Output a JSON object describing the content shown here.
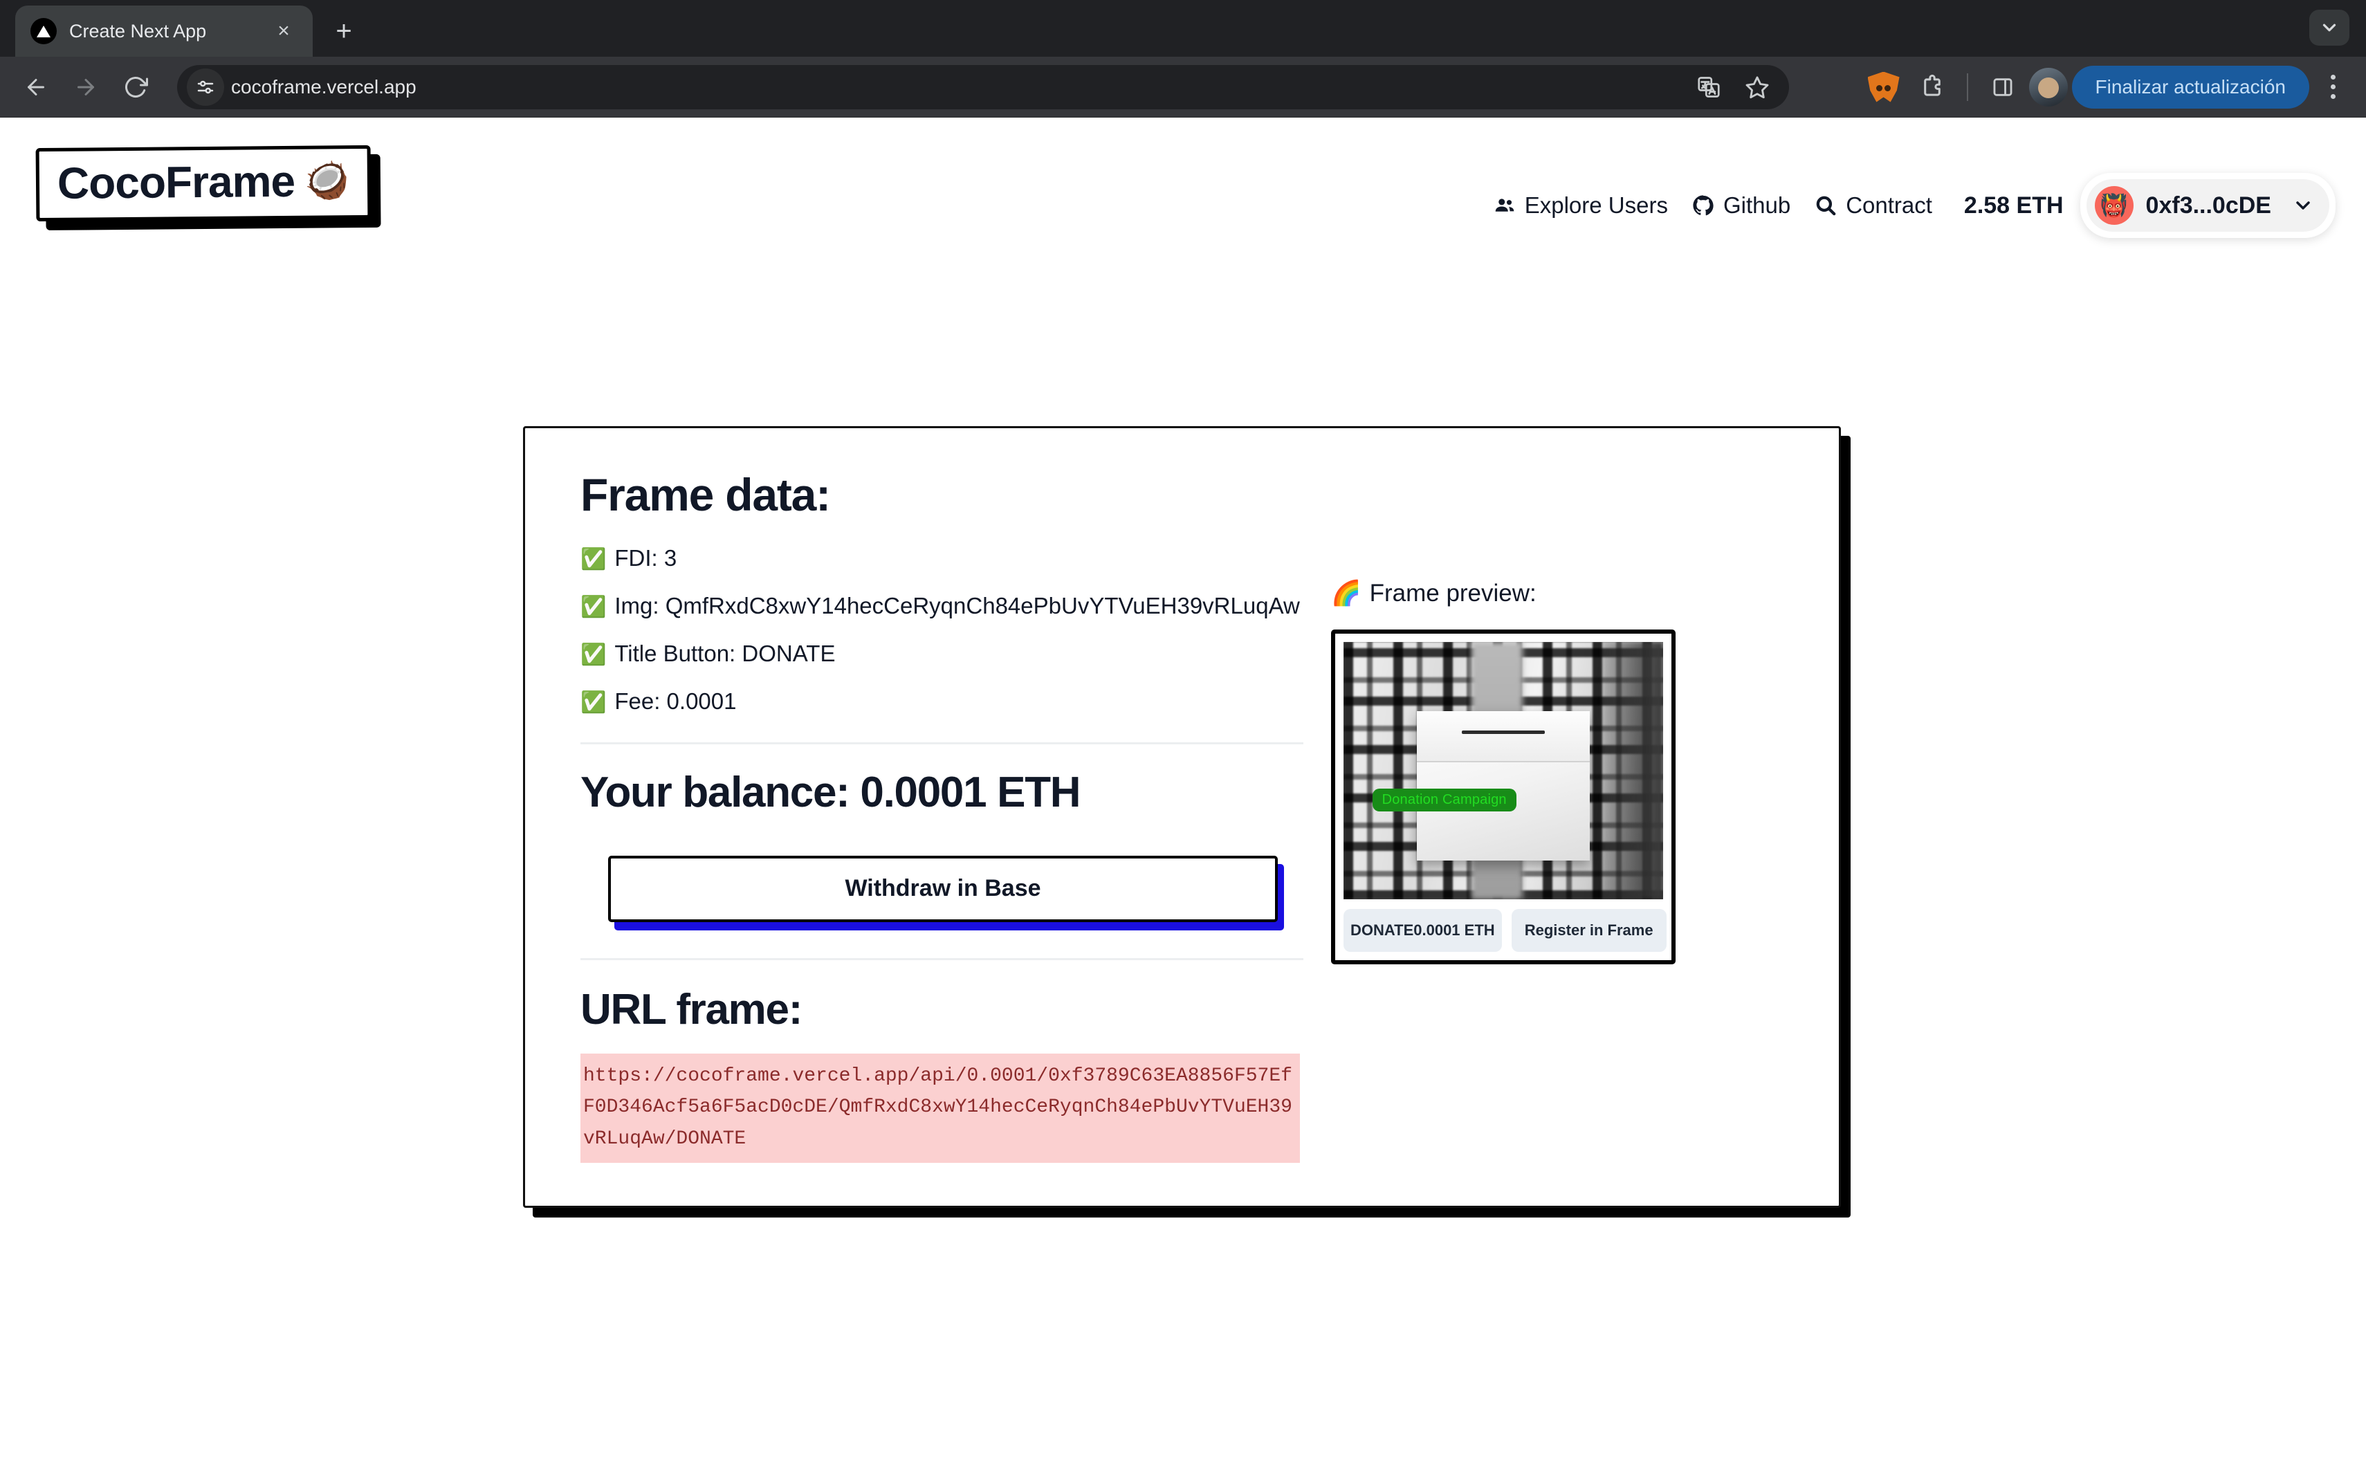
{
  "browser": {
    "tab": {
      "title": "Create Next App",
      "favicon": "nextjs-triangle-icon",
      "close_label": "×"
    },
    "new_tab_label": "+",
    "omnibox": {
      "url": "cocoframe.vercel.app",
      "site_settings_icon": "tune-icon"
    },
    "toolbar": {
      "back_icon": "back-arrow-icon",
      "forward_icon": "forward-arrow-icon",
      "reload_icon": "reload-icon",
      "translate_icon": "translate-icon",
      "bookmark_icon": "star-icon",
      "metamask_icon": "metamask-fox-icon",
      "extensions_icon": "extensions-puzzle-icon",
      "side_panel_icon": "side-panel-icon",
      "profile_icon": "profile-avatar",
      "update_button": "Finalizar actualización",
      "menu_icon": "three-dot-menu-icon"
    },
    "tab_list_icon": "chevron-down-icon"
  },
  "app": {
    "logo": {
      "text": "CocoFrame",
      "emoji": "🥥"
    },
    "nav": {
      "items": [
        {
          "label": "Explore Users",
          "icon": "people-icon"
        },
        {
          "label": "Github",
          "icon": "github-icon"
        },
        {
          "label": "Contract",
          "icon": "search-icon"
        }
      ],
      "eth_balance": "2.58 ETH",
      "wallet": {
        "address": "0xf3...0cDE",
        "avatar": "👹",
        "chevron": "chevron-down-icon"
      }
    },
    "frame_data": {
      "heading": "Frame data:",
      "items": [
        {
          "check": "✅",
          "text": "FDI: 3"
        },
        {
          "check": "✅",
          "text": "Img: QmfRxdC8xwY14hecCeRyqnCh84ePbUvYTVuEH39vRLuqAw"
        },
        {
          "check": "✅",
          "text": "Title Button: DONATE"
        },
        {
          "check": "✅",
          "text": "Fee: 0.0001"
        }
      ]
    },
    "balance": {
      "heading": "Your balance: 0.0001 ETH",
      "withdraw_button": "Withdraw in Base"
    },
    "url_frame": {
      "heading": "URL frame:",
      "url": "https://cocoframe.vercel.app/api/0.0001/0xf3789C63EA8856F57EfF0D346Acf5a6F5acD0cDE/QmfRxdC8xwY14hecCeRyqnCh84ePbUvYTVuEH39vRLuqAw/DONATE"
    },
    "preview": {
      "title": "Frame preview:",
      "title_emoji": "🌈",
      "image_caption": "Donation Campaign",
      "buttons": [
        {
          "label": "DONATE0.0001 ETH"
        },
        {
          "label": "Register in Frame"
        }
      ]
    },
    "colors": {
      "accent_blue": "#1a0fe0",
      "code_bg": "#fbd0d0",
      "code_text": "#8b2b2b",
      "campaign_bg": "#188c18",
      "campaign_text": "#22dd22",
      "wallet_avatar_bg": "#f8675b",
      "update_button_bg": "#1a5b9e"
    }
  }
}
